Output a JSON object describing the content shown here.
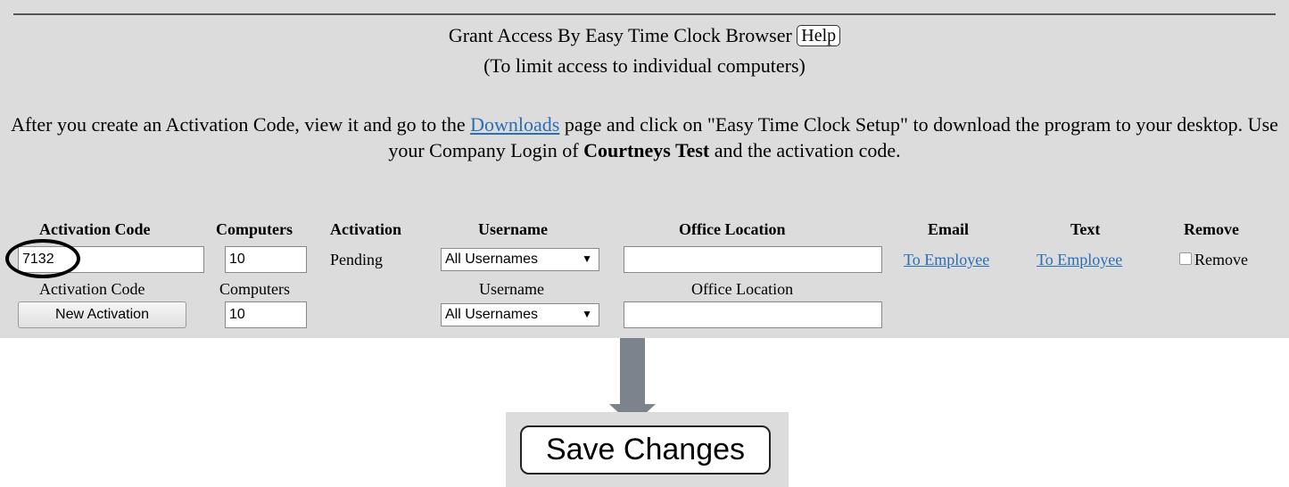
{
  "header": {
    "title": "Grant Access By Easy Time Clock Browser",
    "help_label": "Help",
    "subtitle": "(To limit access to individual computers)"
  },
  "instructions": {
    "part1": "After you create an Activation Code, view it and go to the ",
    "link": "Downloads",
    "part2": " page and click on \"Easy Time Clock Setup\" to download the program to your desktop. Use your Company Login of ",
    "company": "Courtneys Test",
    "part3": " and the activation code."
  },
  "table": {
    "headers": {
      "activation_code": "Activation Code",
      "computers": "Computers",
      "activation": "Activation",
      "username": "Username",
      "office_location": "Office Location",
      "email": "Email",
      "text": "Text",
      "remove": "Remove"
    },
    "row": {
      "activation_code": "7132",
      "computers": "10",
      "activation": "Pending",
      "username": "All Usernames",
      "office_location": "",
      "email_link": "To Employee",
      "text_link": "To Employee",
      "remove_label": "Remove",
      "remove_checked": false
    }
  },
  "new_row": {
    "labels": {
      "activation_code": "Activation Code",
      "computers": "Computers",
      "username": "Username",
      "office_location": "Office Location"
    },
    "button": "New Activation",
    "computers": "10",
    "username": "All Usernames",
    "office_location": ""
  },
  "save_label": "Save Changes",
  "colors": {
    "panel": "#dcdcdc",
    "link": "#2a6fb3",
    "arrow": "#7d838c"
  }
}
